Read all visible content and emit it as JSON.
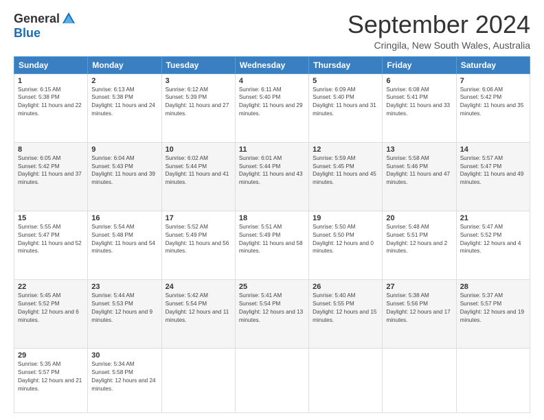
{
  "header": {
    "logo_general": "General",
    "logo_blue": "Blue",
    "month_title": "September 2024",
    "location": "Cringila, New South Wales, Australia"
  },
  "days_of_week": [
    "Sunday",
    "Monday",
    "Tuesday",
    "Wednesday",
    "Thursday",
    "Friday",
    "Saturday"
  ],
  "weeks": [
    [
      {
        "day": 1,
        "sunrise": "6:15 AM",
        "sunset": "5:38 PM",
        "daylight": "11 hours and 22 minutes."
      },
      {
        "day": 2,
        "sunrise": "6:13 AM",
        "sunset": "5:38 PM",
        "daylight": "11 hours and 24 minutes."
      },
      {
        "day": 3,
        "sunrise": "6:12 AM",
        "sunset": "5:39 PM",
        "daylight": "11 hours and 27 minutes."
      },
      {
        "day": 4,
        "sunrise": "6:11 AM",
        "sunset": "5:40 PM",
        "daylight": "11 hours and 29 minutes."
      },
      {
        "day": 5,
        "sunrise": "6:09 AM",
        "sunset": "5:40 PM",
        "daylight": "11 hours and 31 minutes."
      },
      {
        "day": 6,
        "sunrise": "6:08 AM",
        "sunset": "5:41 PM",
        "daylight": "11 hours and 33 minutes."
      },
      {
        "day": 7,
        "sunrise": "6:06 AM",
        "sunset": "5:42 PM",
        "daylight": "11 hours and 35 minutes."
      }
    ],
    [
      {
        "day": 8,
        "sunrise": "6:05 AM",
        "sunset": "5:42 PM",
        "daylight": "11 hours and 37 minutes."
      },
      {
        "day": 9,
        "sunrise": "6:04 AM",
        "sunset": "5:43 PM",
        "daylight": "11 hours and 39 minutes."
      },
      {
        "day": 10,
        "sunrise": "6:02 AM",
        "sunset": "5:44 PM",
        "daylight": "11 hours and 41 minutes."
      },
      {
        "day": 11,
        "sunrise": "6:01 AM",
        "sunset": "5:44 PM",
        "daylight": "11 hours and 43 minutes."
      },
      {
        "day": 12,
        "sunrise": "5:59 AM",
        "sunset": "5:45 PM",
        "daylight": "11 hours and 45 minutes."
      },
      {
        "day": 13,
        "sunrise": "5:58 AM",
        "sunset": "5:46 PM",
        "daylight": "11 hours and 47 minutes."
      },
      {
        "day": 14,
        "sunrise": "5:57 AM",
        "sunset": "5:47 PM",
        "daylight": "11 hours and 49 minutes."
      }
    ],
    [
      {
        "day": 15,
        "sunrise": "5:55 AM",
        "sunset": "5:47 PM",
        "daylight": "11 hours and 52 minutes."
      },
      {
        "day": 16,
        "sunrise": "5:54 AM",
        "sunset": "5:48 PM",
        "daylight": "11 hours and 54 minutes."
      },
      {
        "day": 17,
        "sunrise": "5:52 AM",
        "sunset": "5:49 PM",
        "daylight": "11 hours and 56 minutes."
      },
      {
        "day": 18,
        "sunrise": "5:51 AM",
        "sunset": "5:49 PM",
        "daylight": "11 hours and 58 minutes."
      },
      {
        "day": 19,
        "sunrise": "5:50 AM",
        "sunset": "5:50 PM",
        "daylight": "12 hours and 0 minutes."
      },
      {
        "day": 20,
        "sunrise": "5:48 AM",
        "sunset": "5:51 PM",
        "daylight": "12 hours and 2 minutes."
      },
      {
        "day": 21,
        "sunrise": "5:47 AM",
        "sunset": "5:52 PM",
        "daylight": "12 hours and 4 minutes."
      }
    ],
    [
      {
        "day": 22,
        "sunrise": "5:45 AM",
        "sunset": "5:52 PM",
        "daylight": "12 hours and 6 minutes."
      },
      {
        "day": 23,
        "sunrise": "5:44 AM",
        "sunset": "5:53 PM",
        "daylight": "12 hours and 9 minutes."
      },
      {
        "day": 24,
        "sunrise": "5:42 AM",
        "sunset": "5:54 PM",
        "daylight": "12 hours and 11 minutes."
      },
      {
        "day": 25,
        "sunrise": "5:41 AM",
        "sunset": "5:54 PM",
        "daylight": "12 hours and 13 minutes."
      },
      {
        "day": 26,
        "sunrise": "5:40 AM",
        "sunset": "5:55 PM",
        "daylight": "12 hours and 15 minutes."
      },
      {
        "day": 27,
        "sunrise": "5:38 AM",
        "sunset": "5:56 PM",
        "daylight": "12 hours and 17 minutes."
      },
      {
        "day": 28,
        "sunrise": "5:37 AM",
        "sunset": "5:57 PM",
        "daylight": "12 hours and 19 minutes."
      }
    ],
    [
      {
        "day": 29,
        "sunrise": "5:35 AM",
        "sunset": "5:57 PM",
        "daylight": "12 hours and 21 minutes."
      },
      {
        "day": 30,
        "sunrise": "5:34 AM",
        "sunset": "5:58 PM",
        "daylight": "12 hours and 24 minutes."
      },
      null,
      null,
      null,
      null,
      null
    ]
  ]
}
